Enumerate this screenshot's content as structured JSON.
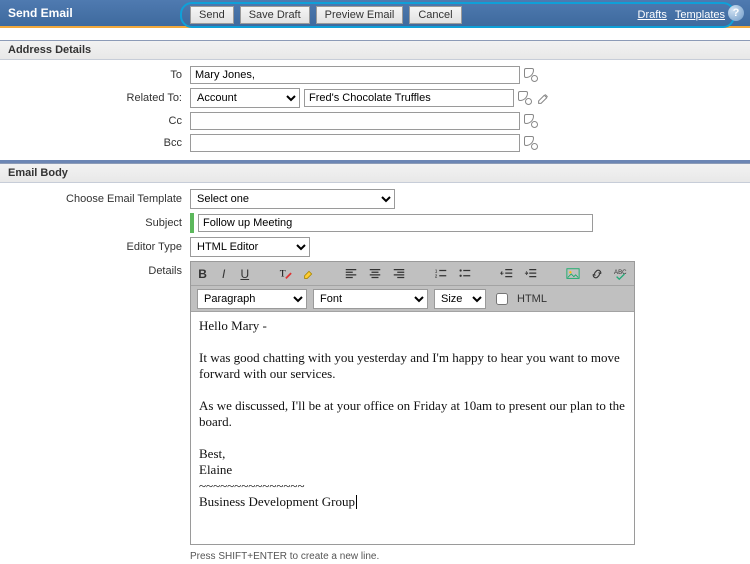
{
  "titlebar": {
    "title": "Send Email",
    "buttons": {
      "send": "Send",
      "save_draft": "Save Draft",
      "preview": "Preview Email",
      "cancel": "Cancel"
    },
    "links": {
      "drafts": "Drafts",
      "templates": "Templates"
    },
    "help": "?"
  },
  "sections": {
    "address": "Address Details",
    "body": "Email Body"
  },
  "address": {
    "labels": {
      "to": "To",
      "related_to": "Related To:",
      "cc": "Cc",
      "bcc": "Bcc"
    },
    "to_value": "Mary Jones,",
    "related_to_type_options": [
      "Account"
    ],
    "related_to_type_value": "Account",
    "related_to_value": "Fred's Chocolate Truffles",
    "cc_value": "",
    "bcc_value": ""
  },
  "body": {
    "labels": {
      "template": "Choose Email Template",
      "subject": "Subject",
      "editor_type": "Editor Type",
      "details": "Details"
    },
    "template_options": [
      "Select one"
    ],
    "template_value": "Select one",
    "subject_value": "Follow up Meeting",
    "editor_type_options": [
      "HTML Editor"
    ],
    "editor_type_value": "HTML Editor",
    "toolbar2": {
      "para_options": [
        "Paragraph"
      ],
      "para_value": "Paragraph",
      "font_options": [
        "Font"
      ],
      "font_value": "Font",
      "size_options": [
        "Size"
      ],
      "size_value": "Size",
      "html_label": "HTML"
    },
    "content": "Hello Mary -\n\nIt was good chatting with you yesterday and I'm happy to hear you want to move forward with our services.\n\nAs we discussed, I'll be at your office on Friday at 10am to present our plan to the board.\n\nBest,\nElaine\n~~~~~~~~~~~~~~~\nBusiness Development Group",
    "hint": "Press SHIFT+ENTER to create a new line."
  }
}
